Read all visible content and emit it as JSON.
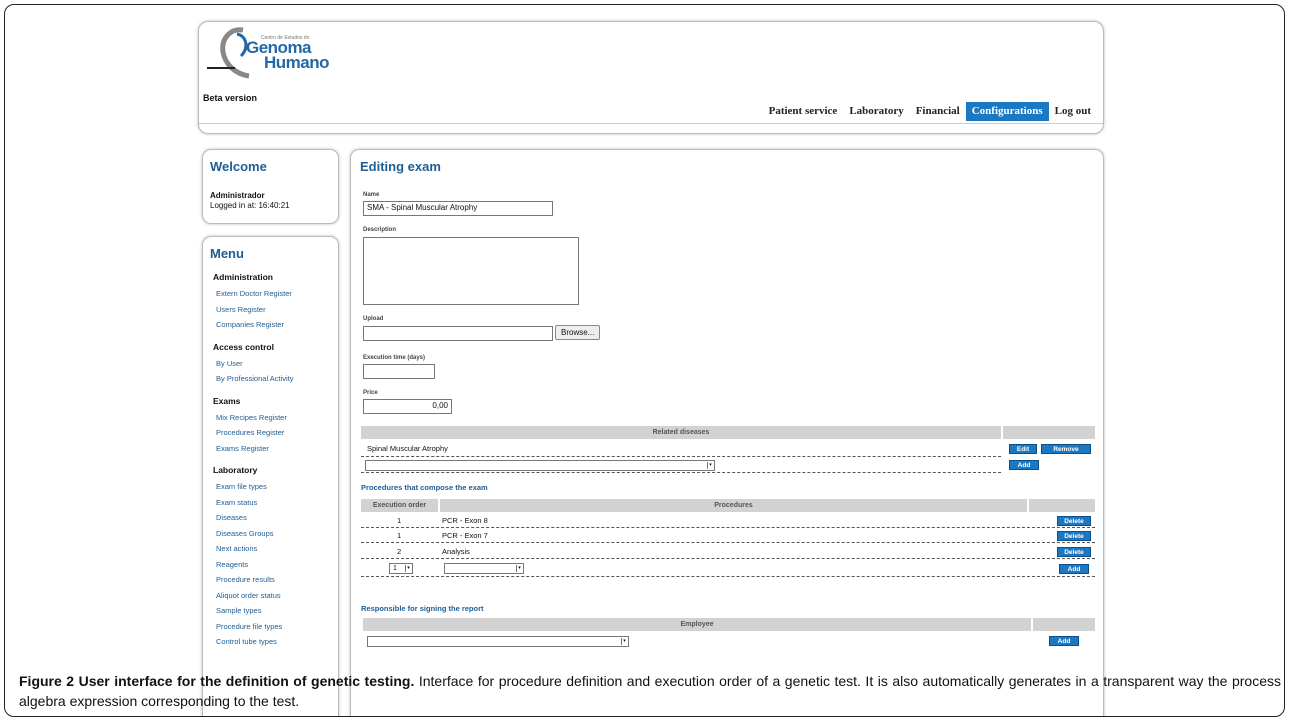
{
  "header": {
    "logo_small": "Centro de Estudos do",
    "logo_line1": "Genoma",
    "logo_line2": "Humano",
    "beta": "Beta version",
    "nav": [
      {
        "label": "Patient service",
        "active": false
      },
      {
        "label": "Laboratory",
        "active": false
      },
      {
        "label": "Financial",
        "active": false
      },
      {
        "label": "Configurations",
        "active": true
      },
      {
        "label": "Log out",
        "active": false
      }
    ]
  },
  "welcome": {
    "title": "Welcome",
    "user": "Administrador",
    "logged": "Logged in at: 16:40:21"
  },
  "menu": {
    "title": "Menu",
    "groups": [
      {
        "title": "Administration",
        "items": [
          "Extern Doctor Register",
          "Users Register",
          "Companies Register"
        ]
      },
      {
        "title": "Access control",
        "items": [
          "By User",
          "By Professional Activity"
        ]
      },
      {
        "title": "Exams",
        "items": [
          "Mix Recipes Register",
          "Procedures Register",
          "Exams Register"
        ]
      },
      {
        "title": "Laboratory",
        "items": [
          "Exam file types",
          "Exam status",
          "Diseases",
          "Diseases Groups",
          "Next actions",
          "Reagents",
          "Procedure results",
          "Aliquot order status",
          "Sample types",
          "Procedure file types",
          "Control tube types"
        ]
      }
    ]
  },
  "main": {
    "title": "Editing exam",
    "name_label": "Name",
    "name_value": "SMA - Spinal Muscular Atrophy",
    "description_label": "Description",
    "upload_label": "Upload",
    "browse_label": "Browse...",
    "exec_time_label": "Execution time (days)",
    "price_label": "Price",
    "price_value": "0,00",
    "related_diseases_header": "Related diseases",
    "related_diseases": [
      "Spinal Muscular Atrophy"
    ],
    "edit_label": "Edit",
    "remove_label": "Remove",
    "add_label": "Add",
    "procedures_title": "Procedures that compose the exam",
    "exec_order_header": "Execution order",
    "procedures_header": "Procedures",
    "procedures": [
      {
        "order": "1",
        "name": "PCR - Exon 8"
      },
      {
        "order": "1",
        "name": "PCR - Exon 7"
      },
      {
        "order": "2",
        "name": "Analysis"
      }
    ],
    "delete_label": "Delete",
    "new_order_value": "1",
    "responsible_title": "Responsible for signing the report",
    "employee_header": "Employee"
  },
  "caption": {
    "title": "Figure 2 User interface for the definition of genetic testing.",
    "text": " Interface for procedure definition and execution order of a genetic test. It is also automatically generates in a transparent way the process algebra expression corresponding to the test."
  },
  "colors": {
    "accent": "#1b78c2",
    "title": "#1f5d93"
  }
}
